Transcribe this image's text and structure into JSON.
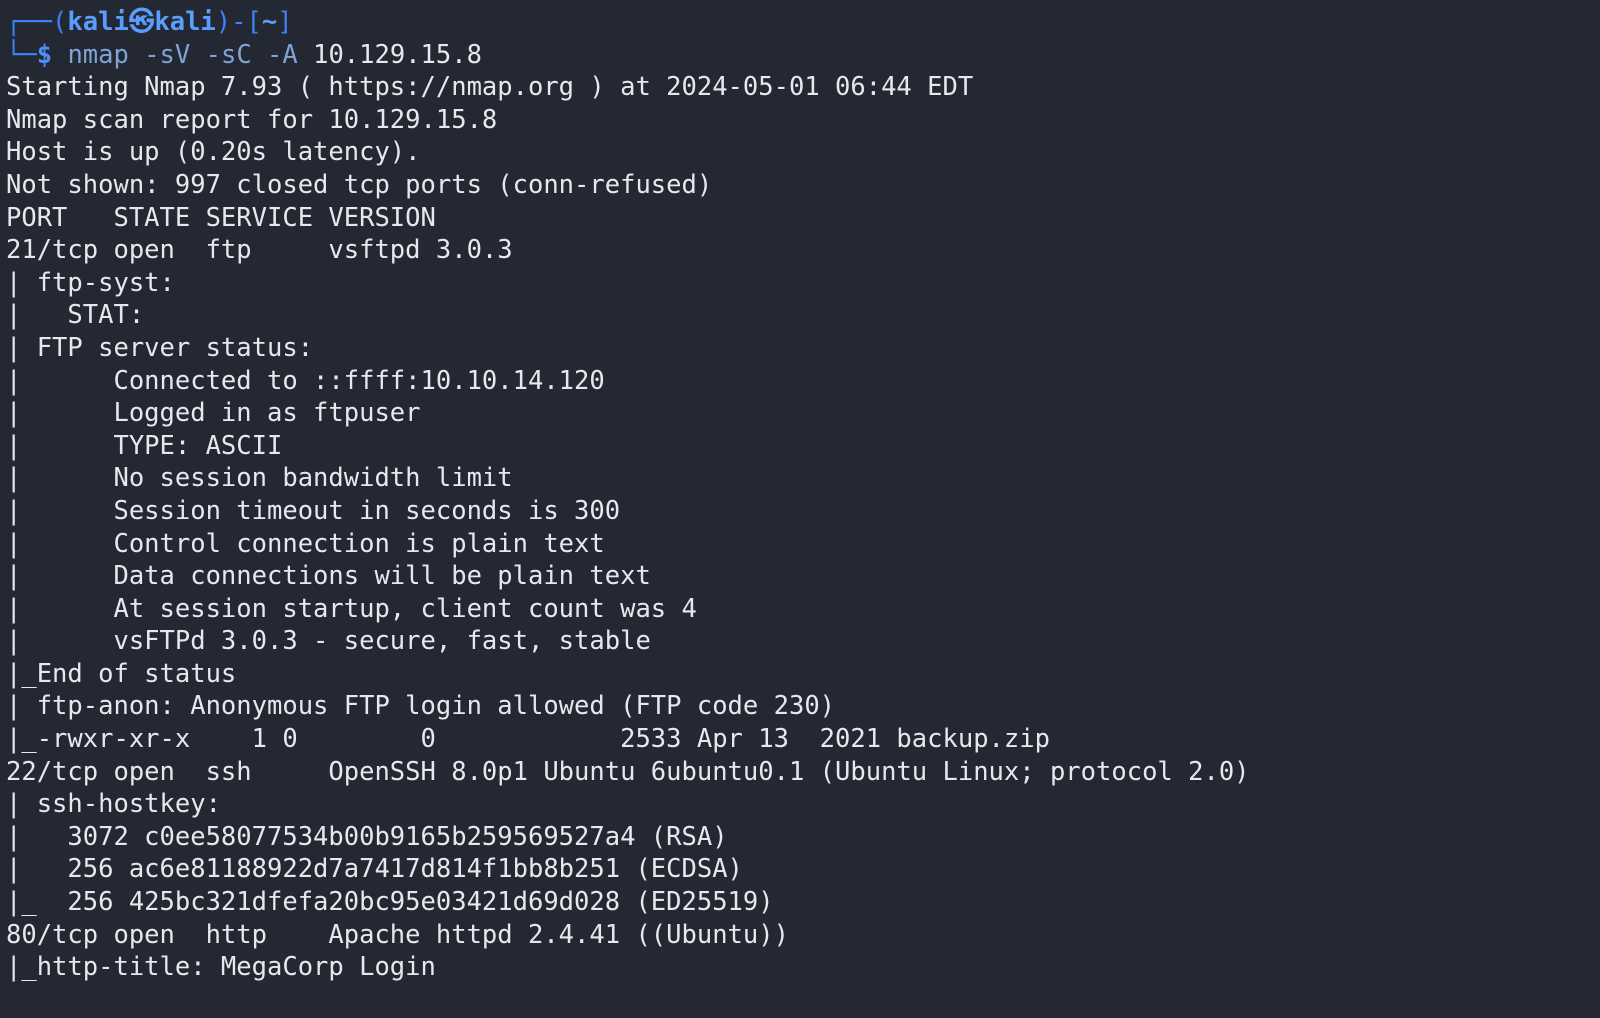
{
  "prompt": {
    "frame_open": "┌──(",
    "user": "kali",
    "at_symbol": "㉿",
    "host": "kali",
    "frame_mid": ")-[",
    "cwd": "~",
    "frame_close": "]",
    "line2_prefix": "└─",
    "dollar": "$",
    "command": "nmap -sV -sC -A",
    "target": "10.129.15.8"
  },
  "output": [
    "Starting Nmap 7.93 ( https://nmap.org ) at 2024-05-01 06:44 EDT",
    "Nmap scan report for 10.129.15.8",
    "Host is up (0.20s latency).",
    "Not shown: 997 closed tcp ports (conn-refused)",
    "PORT   STATE SERVICE VERSION",
    "21/tcp open  ftp     vsftpd 3.0.3",
    "| ftp-syst:",
    "|   STAT:",
    "| FTP server status:",
    "|      Connected to ::ffff:10.10.14.120",
    "|      Logged in as ftpuser",
    "|      TYPE: ASCII",
    "|      No session bandwidth limit",
    "|      Session timeout in seconds is 300",
    "|      Control connection is plain text",
    "|      Data connections will be plain text",
    "|      At session startup, client count was 4",
    "|      vsFTPd 3.0.3 - secure, fast, stable",
    "|_End of status",
    "| ftp-anon: Anonymous FTP login allowed (FTP code 230)",
    "|_-rwxr-xr-x    1 0        0            2533 Apr 13  2021 backup.zip",
    "22/tcp open  ssh     OpenSSH 8.0p1 Ubuntu 6ubuntu0.1 (Ubuntu Linux; protocol 2.0)",
    "| ssh-hostkey:",
    "|   3072 c0ee58077534b00b9165b259569527a4 (RSA)",
    "|   256 ac6e81188922d7a7417d814f1bb8b251 (ECDSA)",
    "|_  256 425bc321dfefa20bc95e03421d69d028 (ED25519)",
    "80/tcp open  http    Apache httpd 2.4.41 ((Ubuntu))",
    "|_http-title: MegaCorp Login"
  ]
}
